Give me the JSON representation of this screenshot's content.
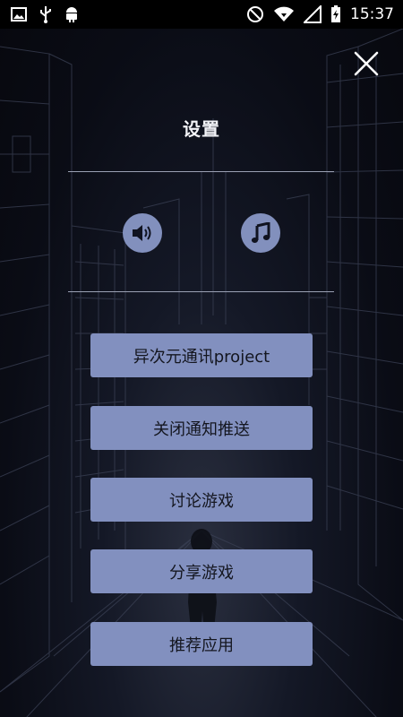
{
  "status_bar": {
    "time": "15:37",
    "left_icons": [
      "image-icon",
      "usb-icon",
      "android-icon"
    ],
    "right_icons": [
      "do-not-disturb-icon",
      "wifi-icon",
      "signal-icon",
      "battery-charging-icon"
    ]
  },
  "settings": {
    "title": "设置",
    "sound_toggle_icon": "speaker-icon",
    "music_toggle_icon": "music-note-icon"
  },
  "menu": {
    "items": [
      {
        "label": "异次元通讯project"
      },
      {
        "label": "关闭通知推送"
      },
      {
        "label": "讨论游戏"
      },
      {
        "label": "分享游戏"
      },
      {
        "label": "推荐应用"
      }
    ]
  },
  "colors": {
    "button": "#8290bf",
    "button_text": "#14161f",
    "title": "#f2f3f7",
    "background": "#0a0c14"
  }
}
